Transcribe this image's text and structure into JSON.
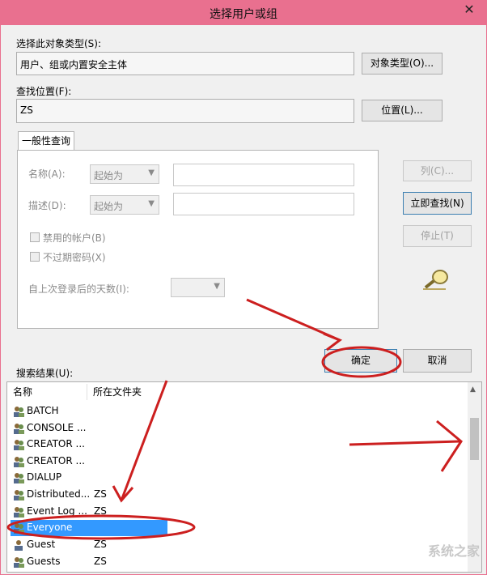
{
  "window": {
    "title": "选择用户或组",
    "close_glyph": "✕"
  },
  "object_type": {
    "label": "选择此对象类型(S):",
    "value": "用户、组或内置安全主体",
    "button": "对象类型(O)..."
  },
  "location": {
    "label": "查找位置(F):",
    "value": "ZS",
    "button": "位置(L)..."
  },
  "query": {
    "tab": "一般性查询",
    "name_label": "名称(A):",
    "name_combo": "起始为",
    "desc_label": "描述(D):",
    "desc_combo": "起始为",
    "disabled_accounts": "禁用的帐户(B)",
    "non_expiring": "不过期密码(X)",
    "days_label": "自上次登录后的天数(I):"
  },
  "side_buttons": {
    "columns": "列(C)...",
    "find_now": "立即查找(N)",
    "stop": "停止(T)"
  },
  "actions": {
    "ok": "确定",
    "cancel": "取消"
  },
  "results": {
    "label": "搜索结果(U):",
    "columns": [
      "名称",
      "所在文件夹"
    ],
    "rows": [
      {
        "name": "BATCH",
        "folder": ""
      },
      {
        "name": "CONSOLE ...",
        "folder": ""
      },
      {
        "name": "CREATOR ...",
        "folder": ""
      },
      {
        "name": "CREATOR ...",
        "folder": ""
      },
      {
        "name": "DIALUP",
        "folder": ""
      },
      {
        "name": "Distributed...",
        "folder": "ZS"
      },
      {
        "name": "Event Log ...",
        "folder": "ZS"
      },
      {
        "name": "Everyone",
        "folder": "",
        "selected": true
      },
      {
        "name": "Guest",
        "folder": "ZS"
      },
      {
        "name": "Guests",
        "folder": "ZS"
      }
    ]
  },
  "watermark": "系统之家",
  "colors": {
    "titlebar": "#e9708f",
    "selection": "#3399ff",
    "annotation": "#cc1f1f"
  }
}
